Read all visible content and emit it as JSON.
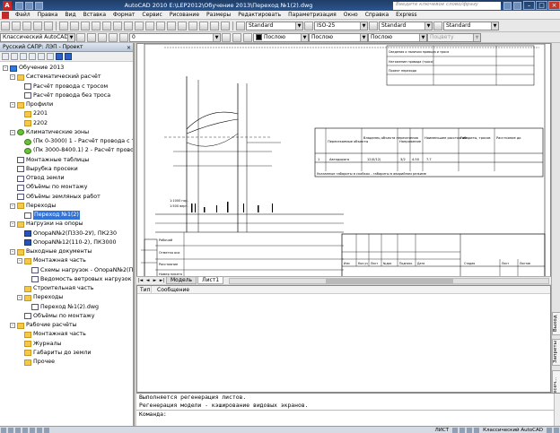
{
  "titlebar": {
    "title": "AutoCAD 2010    E:\\LEP2012\\Обучение 2013\\Переход №1(2).dwg",
    "search_placeholder": "Введите ключевое слово/фразу"
  },
  "menu": [
    "Файл",
    "Правка",
    "Вид",
    "Вставка",
    "Формат",
    "Сервис",
    "Рисование",
    "Размеры",
    "Редактировать",
    "Параметризация",
    "Окно",
    "Справка",
    "Express"
  ],
  "toolbar": {
    "text_style": "Standard",
    "dim_style": "ISO-25",
    "table_style": "Standard",
    "multileader_style": "Standard",
    "workspace": "Классический AutoCAD",
    "layer": "0",
    "color": "Послою",
    "linetype": "Послою",
    "lineweight": "Послою",
    "plot_style": "Поцвету"
  },
  "project_panel": {
    "title": "Русский САПР: ЛЭП - Проект",
    "tree": [
      {
        "label": "Обучение 2013",
        "level": 0,
        "icon": "root",
        "expand": "-"
      },
      {
        "label": "Систематический расчёт",
        "level": 1,
        "icon": "folder",
        "expand": "-"
      },
      {
        "label": "Расчёт провода с тросом",
        "level": 2,
        "icon": "doc",
        "expand": ""
      },
      {
        "label": "Расчёт провода без троса",
        "level": 2,
        "icon": "doc",
        "expand": ""
      },
      {
        "label": "Профили",
        "level": 1,
        "icon": "folder",
        "expand": "-"
      },
      {
        "label": "2201",
        "level": 2,
        "icon": "folder",
        "expand": ""
      },
      {
        "label": "2202",
        "level": 2,
        "icon": "folder",
        "expand": ""
      },
      {
        "label": "Климатические зоны",
        "level": 1,
        "icon": "climate",
        "expand": "-"
      },
      {
        "label": "(Пк 0-3000) 1 - Расчёт провода с тросом",
        "level": 2,
        "icon": "climate",
        "expand": ""
      },
      {
        "label": "(Пк 3000-8400.1) 2 - Расчёт провода без т",
        "level": 2,
        "icon": "climate",
        "expand": ""
      },
      {
        "label": "Монтажные таблицы",
        "level": 1,
        "icon": "doc",
        "expand": ""
      },
      {
        "label": "Вырубка просеки",
        "level": 1,
        "icon": "doc",
        "expand": ""
      },
      {
        "label": "Отвод земли",
        "level": 1,
        "icon": "doc",
        "expand": ""
      },
      {
        "label": "Объёмы по монтажу",
        "level": 1,
        "icon": "doc",
        "expand": ""
      },
      {
        "label": "Объёмы земляных работ",
        "level": 1,
        "icon": "doc",
        "expand": ""
      },
      {
        "label": "Переходы",
        "level": 1,
        "icon": "folder",
        "expand": "-"
      },
      {
        "label": "Переход №1(2)",
        "level": 2,
        "icon": "doc",
        "expand": "",
        "selected": true
      },
      {
        "label": "Нагрузки на опоры",
        "level": 1,
        "icon": "folder",
        "expand": "-"
      },
      {
        "label": "ОпораN№2(П330-2У), ПК230",
        "level": 2,
        "icon": "pole",
        "expand": ""
      },
      {
        "label": "ОпораN№12(110-2), ПК3000",
        "level": 2,
        "icon": "pole",
        "expand": ""
      },
      {
        "label": "Выходные документы",
        "level": 1,
        "icon": "folder",
        "expand": "-"
      },
      {
        "label": "Монтажная часть",
        "level": 2,
        "icon": "folder",
        "expand": "-"
      },
      {
        "label": "Схемы нагрузок - ОпораN№2(П110-4В),",
        "level": 3,
        "icon": "doc",
        "expand": ""
      },
      {
        "label": "Ведомость ветровых нагрузок - Опора",
        "level": 3,
        "icon": "doc",
        "expand": ""
      },
      {
        "label": "Строительная часть",
        "level": 2,
        "icon": "folder",
        "expand": ""
      },
      {
        "label": "Переходы",
        "level": 2,
        "icon": "folder",
        "expand": "-"
      },
      {
        "label": "Переход №1(2).dwg",
        "level": 3,
        "icon": "doc",
        "expand": ""
      },
      {
        "label": "Объёмы по монтажу",
        "level": 2,
        "icon": "doc",
        "expand": ""
      },
      {
        "label": "Рабочие расчёты",
        "level": 1,
        "icon": "folder",
        "expand": "-"
      },
      {
        "label": "Монтажная часть",
        "level": 2,
        "icon": "folder",
        "expand": ""
      },
      {
        "label": "Журналы",
        "level": 2,
        "icon": "folder",
        "expand": ""
      },
      {
        "label": "Габариты до земли",
        "level": 2,
        "icon": "folder",
        "expand": ""
      },
      {
        "label": "Прочее",
        "level": 2,
        "icon": "folder",
        "expand": ""
      }
    ]
  },
  "layout_tabs": [
    "Модель",
    "Лист1"
  ],
  "active_layout": "Лист1",
  "messages": {
    "col_type": "Тип",
    "col_message": "Сообщение"
  },
  "side_tabs": [
    "Выход",
    "Запреты",
    "Пересеч..."
  ],
  "command_lines": [
    "Выполняется регенерация листов.",
    "Регенерация модели - кэширование видовых экранов.",
    "Команда:"
  ],
  "status": {
    "mode": "ЛИСТ",
    "workspace": "Классический AutoCAD"
  },
  "drawing": {
    "table_headers": [
      "Пересекаемые объекты",
      "Владелец объекта пересечения",
      "Напряжение",
      "Наименьшее расстояние",
      "Габариты, тросов",
      "Расстояние до"
    ],
    "table_row": [
      "1",
      "Автодорога",
      "12(0/12)",
      "3/2",
      "4.50",
      "7.7"
    ],
    "table_note": "Указанные габариты в скобках - габариты в аварийном режиме",
    "info_rows": [
      "Сведения о наличии провода и троса",
      "Натяжение провода (троса)",
      "Проект перехода"
    ],
    "stamp_labels": [
      "Изм",
      "Кол.уч",
      "Лист",
      "№док",
      "Подпись",
      "Дата",
      "Стадия",
      "Лист",
      "Листов"
    ],
    "profile_rows": [
      "Рабочий",
      "Отметка оси",
      "Расстояние",
      "Номер пикета"
    ]
  }
}
